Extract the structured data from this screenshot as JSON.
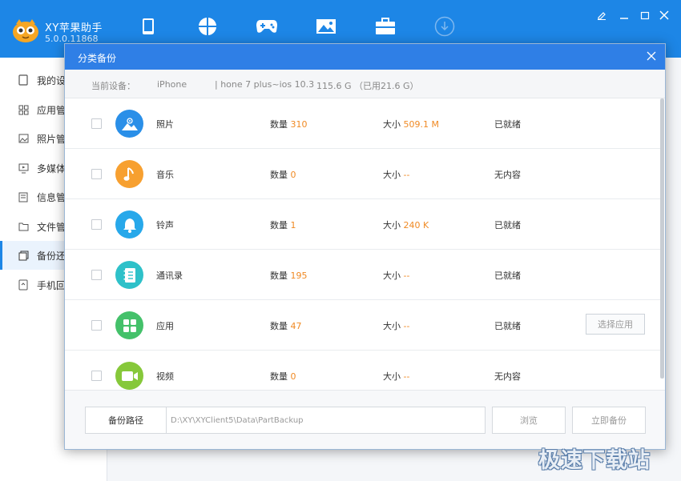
{
  "app": {
    "name": "XY苹果助手",
    "version": "5.0.0.11868"
  },
  "top_nav": [
    {
      "icon": "phone-icon"
    },
    {
      "icon": "apps-icon"
    },
    {
      "icon": "gamepad-icon"
    },
    {
      "icon": "image-icon"
    },
    {
      "icon": "toolbox-icon"
    },
    {
      "icon": "download-icon"
    }
  ],
  "sidebar": {
    "items": [
      {
        "label": "我的设",
        "icon": "device-icon"
      },
      {
        "label": "应用管",
        "icon": "grid-icon"
      },
      {
        "label": "照片管",
        "icon": "photo-icon"
      },
      {
        "label": "多媒体",
        "icon": "monitor-icon"
      },
      {
        "label": "信息管",
        "icon": "contact-icon"
      },
      {
        "label": "文件管",
        "icon": "folder-icon"
      },
      {
        "label": "备份还",
        "icon": "backup-icon"
      },
      {
        "label": "手机回",
        "icon": "recycle-icon"
      }
    ],
    "active_index": 6
  },
  "modal": {
    "title": "分类备份",
    "device": {
      "label": "当前设备：",
      "name": "iPhone",
      "model": "| hone 7 plus~ios 10.3",
      "storage": "115.6 G （已用21.6 G）"
    },
    "count_label": "数量",
    "size_label": "大小",
    "rows": [
      {
        "name": "照片",
        "count": "310",
        "size": "509.1 M",
        "status": "已就绪",
        "icon": "photo-category-icon",
        "color": "#2a8fe8"
      },
      {
        "name": "音乐",
        "count": "0",
        "size": "--",
        "status": "无内容",
        "icon": "music-note-icon",
        "color": "#f7a030"
      },
      {
        "name": "铃声",
        "count": "1",
        "size": "240 K",
        "status": "已就绪",
        "icon": "bell-icon",
        "color": "#27a8ea"
      },
      {
        "name": "通讯录",
        "count": "195",
        "size": "--",
        "status": "已就绪",
        "icon": "contacts-book-icon",
        "color": "#2ec1c9"
      },
      {
        "name": "应用",
        "count": "47",
        "size": "--",
        "status": "已就绪",
        "icon": "apps-grid-icon",
        "color": "#44c16a",
        "action": "选择应用"
      },
      {
        "name": "视频",
        "count": "0",
        "size": "--",
        "status": "无内容",
        "icon": "video-camera-icon",
        "color": "#86c83a"
      }
    ],
    "footer": {
      "path_label": "备份路径",
      "path_value": "D:\\XY\\XYClient5\\Data\\PartBackup",
      "browse_label": "浏览",
      "backup_label": "立即备份"
    }
  },
  "watermark": "极速下载站"
}
